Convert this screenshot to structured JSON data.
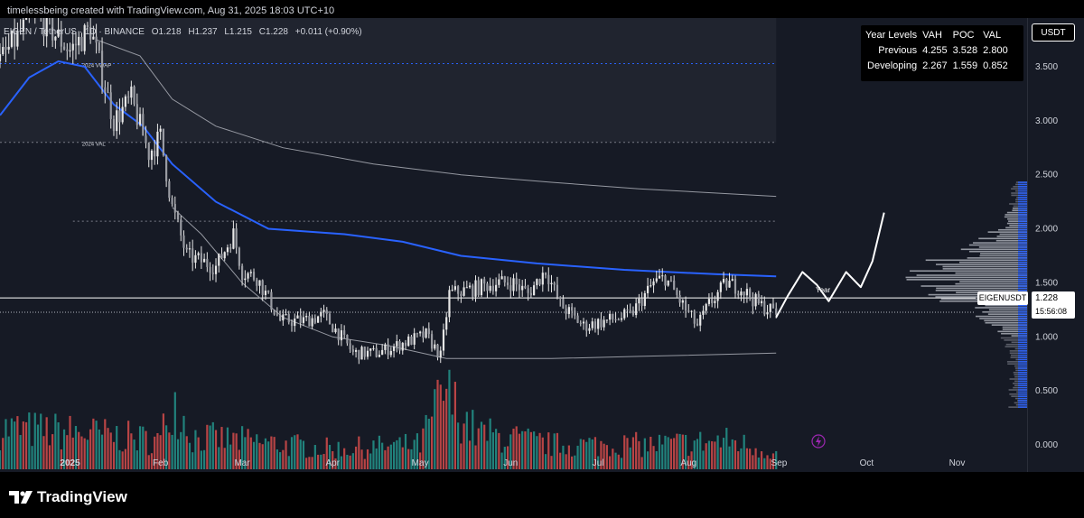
{
  "caption": "timelessbeing created with TradingView.com, Aug 31, 2025 18:03 UTC+10",
  "header": {
    "symbol": "EIGEN / TetherUS · 1D · BINANCE",
    "open": "O1.218",
    "high": "H1.237",
    "low": "L1.215",
    "close": "C1.228",
    "change": "+0.011 (+0.90%)"
  },
  "year_levels": {
    "headers": [
      "Year Levels",
      "VAH",
      "POC",
      "VAL"
    ],
    "rows": [
      {
        "label": "Previous",
        "vah": "4.255",
        "poc": "3.528",
        "val": "2.800"
      },
      {
        "label": "Developing",
        "vah": "2.267",
        "poc": "1.559",
        "val": "0.852"
      }
    ]
  },
  "currency": "USDT",
  "symbol_tag": "EIGENUSDT",
  "last_price": "1.228",
  "countdown": "15:56:08",
  "brand": "TradingView",
  "colors": {
    "background": "#161a25",
    "candle": "#e6e6e6",
    "vwap": "#2962ff",
    "band": "#9598a1",
    "vol_up": "#26a69a",
    "vol_down": "#ef5350",
    "level_blue": "#2962ff",
    "level_grey": "#787b86",
    "profile": "#b2b5be",
    "profile_value": "#2962ff"
  },
  "chart_data": {
    "type": "candlestick",
    "yticks": [
      "3.500",
      "3.000",
      "2.500",
      "2.000",
      "1.500",
      "1.000",
      "0.500",
      "0.000"
    ],
    "ytick_values": [
      3.5,
      3.0,
      2.5,
      2.0,
      1.5,
      1.0,
      0.5,
      0.0
    ],
    "ylim": [
      -0.25,
      3.95
    ],
    "xlabels": [
      "2025",
      "Feb",
      "Mar",
      "Apr",
      "May",
      "Jun",
      "Jul",
      "Aug",
      "Sep",
      "Oct",
      "Nov"
    ],
    "xlabel_dates": [
      "2025-01-01",
      "2025-02-01",
      "2025-03-01",
      "2025-04-01",
      "2025-05-01",
      "2025-06-01",
      "2025-07-01",
      "2025-08-01",
      "2025-09-01",
      "2025-10-01",
      "2025-11-01"
    ],
    "x_range": [
      "2024-12-08",
      "2025-11-25"
    ],
    "price_anchors": [
      [
        "2024-12-08",
        3.55
      ],
      [
        "2024-12-20",
        4.0
      ],
      [
        "2025-01-01",
        3.65
      ],
      [
        "2025-01-08",
        3.85
      ],
      [
        "2025-01-16",
        3.0
      ],
      [
        "2025-01-22",
        3.2
      ],
      [
        "2025-01-28",
        2.7
      ],
      [
        "2025-02-01",
        2.85
      ],
      [
        "2025-02-05",
        2.2
      ],
      [
        "2025-02-10",
        1.75
      ],
      [
        "2025-02-20",
        1.65
      ],
      [
        "2025-02-26",
        1.95
      ],
      [
        "2025-03-01",
        1.6
      ],
      [
        "2025-03-06",
        1.55
      ],
      [
        "2025-03-14",
        1.15
      ],
      [
        "2025-03-22",
        1.15
      ],
      [
        "2025-03-29",
        1.2
      ],
      [
        "2025-04-04",
        1.0
      ],
      [
        "2025-04-08",
        0.85
      ],
      [
        "2025-04-16",
        0.85
      ],
      [
        "2025-04-26",
        0.95
      ],
      [
        "2025-05-03",
        1.02
      ],
      [
        "2025-05-08",
        0.82
      ],
      [
        "2025-05-11",
        1.4
      ],
      [
        "2025-05-20",
        1.45
      ],
      [
        "2025-05-27",
        1.5
      ],
      [
        "2025-06-02",
        1.5
      ],
      [
        "2025-06-07",
        1.4
      ],
      [
        "2025-06-13",
        1.62
      ],
      [
        "2025-06-18",
        1.3
      ],
      [
        "2025-06-26",
        1.1
      ],
      [
        "2025-07-04",
        1.15
      ],
      [
        "2025-07-12",
        1.2
      ],
      [
        "2025-07-20",
        1.5
      ],
      [
        "2025-07-24",
        1.55
      ],
      [
        "2025-07-31",
        1.25
      ],
      [
        "2025-08-04",
        1.1
      ],
      [
        "2025-08-08",
        1.3
      ],
      [
        "2025-08-14",
        1.5
      ],
      [
        "2025-08-19",
        1.45
      ],
      [
        "2025-08-25",
        1.3
      ],
      [
        "2025-08-31",
        1.228
      ]
    ],
    "vwap": [
      [
        "2024-12-08",
        3.05
      ],
      [
        "2024-12-18",
        3.4
      ],
      [
        "2024-12-28",
        3.55
      ],
      [
        "2025-01-06",
        3.5
      ],
      [
        "2025-01-16",
        3.15
      ],
      [
        "2025-01-26",
        2.95
      ],
      [
        "2025-02-05",
        2.6
      ],
      [
        "2025-02-20",
        2.25
      ],
      [
        "2025-03-10",
        2.0
      ],
      [
        "2025-04-05",
        1.95
      ],
      [
        "2025-04-25",
        1.88
      ],
      [
        "2025-05-15",
        1.75
      ],
      [
        "2025-06-10",
        1.68
      ],
      [
        "2025-07-10",
        1.62
      ],
      [
        "2025-08-10",
        1.58
      ],
      [
        "2025-08-31",
        1.56
      ]
    ],
    "upper_band": [
      [
        "2025-01-10",
        3.75
      ],
      [
        "2025-01-25",
        3.6
      ],
      [
        "2025-02-05",
        3.2
      ],
      [
        "2025-02-20",
        2.95
      ],
      [
        "2025-03-15",
        2.75
      ],
      [
        "2025-04-15",
        2.6
      ],
      [
        "2025-05-15",
        2.5
      ],
      [
        "2025-06-15",
        2.43
      ],
      [
        "2025-07-15",
        2.37
      ],
      [
        "2025-08-31",
        2.3
      ]
    ],
    "lower_band": [
      [
        "2025-02-05",
        2.2
      ],
      [
        "2025-02-15",
        1.95
      ],
      [
        "2025-03-01",
        1.5
      ],
      [
        "2025-03-15",
        1.18
      ],
      [
        "2025-04-01",
        1.0
      ],
      [
        "2025-04-20",
        0.92
      ],
      [
        "2025-05-10",
        0.8
      ],
      [
        "2025-06-15",
        0.8
      ],
      [
        "2025-07-15",
        0.82
      ],
      [
        "2025-08-31",
        0.85
      ]
    ],
    "year_open_level": 1.36,
    "year_open_label": "Year",
    "last_price_value": 1.228,
    "levels": [
      {
        "name": "prev-poc",
        "value": 3.528,
        "style": "blue-dotted",
        "label": "2024 VWAP"
      },
      {
        "name": "prev-val",
        "value": 2.8,
        "style": "grey-dotted",
        "label": "2024 VAL"
      },
      {
        "name": "dev-vah",
        "value": 2.07,
        "style": "grey-dotted",
        "label": ""
      }
    ],
    "projection": [
      [
        "2025-08-31",
        1.18
      ],
      [
        "2025-09-04",
        1.38
      ],
      [
        "2025-09-09",
        1.6
      ],
      [
        "2025-09-14",
        1.48
      ],
      [
        "2025-09-18",
        1.33
      ],
      [
        "2025-09-24",
        1.6
      ],
      [
        "2025-09-29",
        1.46
      ],
      [
        "2025-10-03",
        1.7
      ],
      [
        "2025-10-07",
        2.15
      ]
    ],
    "volume_anchors": [
      [
        "2024-12-08",
        0.5
      ],
      [
        "2025-01-05",
        0.45
      ],
      [
        "2025-02-01",
        0.35
      ],
      [
        "2025-02-05",
        0.9
      ],
      [
        "2025-02-12",
        0.4
      ],
      [
        "2025-03-01",
        0.35
      ],
      [
        "2025-04-01",
        0.25
      ],
      [
        "2025-05-01",
        0.3
      ],
      [
        "2025-05-09",
        0.95
      ],
      [
        "2025-05-20",
        0.45
      ],
      [
        "2025-06-15",
        0.3
      ],
      [
        "2025-07-20",
        0.3
      ],
      [
        "2025-08-15",
        0.35
      ],
      [
        "2025-08-31",
        0.2
      ]
    ],
    "volume_profile": {
      "price_range": [
        0.35,
        2.45
      ],
      "peak_price": 1.55,
      "value_area": [
        1.0,
        2.2
      ]
    }
  }
}
